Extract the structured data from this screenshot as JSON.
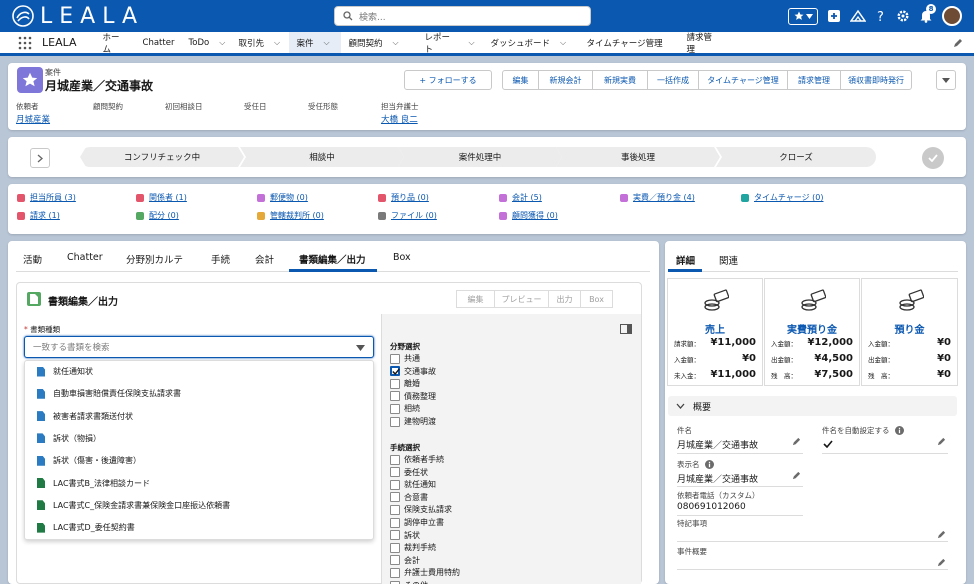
{
  "colors": {
    "brand": "#0b58b1",
    "record_icon": "#7f76d9",
    "doc_icon": "#54a862",
    "xls": "#1f7a43"
  },
  "header": {
    "logo": "LEALA",
    "search_placeholder": "検索...",
    "notification_count": "8"
  },
  "nav": {
    "app_name": "LEALA",
    "items": [
      {
        "label": "ホーム",
        "chevron": false
      },
      {
        "label": "Chatter",
        "chevron": false
      },
      {
        "label": "ToDo",
        "chevron": true
      },
      {
        "label": "取引先",
        "chevron": true
      },
      {
        "label": "案件",
        "chevron": true,
        "active": true
      },
      {
        "label": "顧問契約",
        "chevron": true
      },
      {
        "label": "レポート",
        "chevron": true
      },
      {
        "label": "ダッシュボード",
        "chevron": true
      },
      {
        "label": "タイムチャージ管理",
        "chevron": false
      },
      {
        "label": "請求管理",
        "chevron": false
      }
    ]
  },
  "record": {
    "type": "案件",
    "title": "月城産業／交通事故",
    "follow_label": "+ フォローする",
    "actions": [
      "編集",
      "新規会計",
      "新規実費",
      "一括作成",
      "タイムチャージ管理",
      "請求管理",
      "領収書即時発行"
    ],
    "fields": [
      {
        "label": "依頼者",
        "value": "月城産業",
        "link": true
      },
      {
        "label": "顧問契約",
        "value": ""
      },
      {
        "label": "初回相談日",
        "value": ""
      },
      {
        "label": "受任日",
        "value": ""
      },
      {
        "label": "受任形態",
        "value": ""
      },
      {
        "label": "担当弁護士",
        "value": "大橋 良二",
        "link": true
      }
    ]
  },
  "path": {
    "stages": [
      "コンフリチェック中",
      "相談中",
      "案件処理中",
      "事後処理",
      "クローズ"
    ]
  },
  "related": {
    "row1": [
      {
        "label": "担当所員 (3)",
        "color": "#e3556b"
      },
      {
        "label": "関係者 (1)",
        "color": "#e3556b"
      },
      {
        "label": "郵便物 (0)",
        "color": "#c470d9"
      },
      {
        "label": "預り品 (0)",
        "color": "#e3556b"
      },
      {
        "label": "会計 (5)",
        "color": "#c470d9"
      },
      {
        "label": "実費／預り金 (4)",
        "color": "#c470d9"
      },
      {
        "label": "タイムチャージ (0)",
        "color": "#21a5a0"
      }
    ],
    "row2": [
      {
        "label": "請求 (1)",
        "color": "#e3556b"
      },
      {
        "label": "配分 (0)",
        "color": "#54a862"
      },
      {
        "label": "管轄裁判所 (0)",
        "color": "#e5a93a"
      },
      {
        "label": "ファイル (0)",
        "color": "#7a7a7a"
      },
      {
        "label": "顧問獲得 (0)",
        "color": "#c470d9"
      }
    ]
  },
  "main": {
    "tabs": [
      "活動",
      "Chatter",
      "分野別カルテ",
      "手続",
      "会計",
      "書類編集／出力",
      "Box"
    ],
    "active_tab": "書類編集／出力",
    "panel_title": "書類編集／出力",
    "panel_buttons": [
      "編集",
      "プレビュー",
      "出力",
      "Box"
    ],
    "doc_type_label": "書類種類",
    "required_mark": "*",
    "combo_placeholder": "一致する書類を検索",
    "doc_options": [
      "就任通知状",
      "自動車損害賠償責任保険支払請求書",
      "被害者請求書類送付状",
      "訴状（物損）",
      "訴状（傷害・後遺障害）",
      "LAC書式B_法律相談カード",
      "LAC書式C_保険金請求書兼保険金口座振込依頼書",
      "LAC書式D_委任契約書"
    ],
    "field_section": "分野選択",
    "fields": [
      {
        "label": "共通",
        "checked": false
      },
      {
        "label": "交通事故",
        "checked": true
      },
      {
        "label": "離婚",
        "checked": false
      },
      {
        "label": "債務整理",
        "checked": false
      },
      {
        "label": "相続",
        "checked": false
      },
      {
        "label": "建物明渡",
        "checked": false
      }
    ],
    "proc_section": "手続選択",
    "procs": [
      {
        "label": "依頼者手続",
        "checked": false
      },
      {
        "label": "委任状",
        "checked": false
      },
      {
        "label": "就任通知",
        "checked": false
      },
      {
        "label": "合意書",
        "checked": false
      },
      {
        "label": "保険支払請求",
        "checked": false
      },
      {
        "label": "調停申立書",
        "checked": false
      },
      {
        "label": "訴状",
        "checked": false
      },
      {
        "label": "裁判手続",
        "checked": false
      },
      {
        "label": "会計",
        "checked": false
      },
      {
        "label": "弁護士費用特約",
        "checked": false
      },
      {
        "label": "その他",
        "checked": false
      }
    ]
  },
  "side": {
    "tabs": [
      "詳細",
      "関連"
    ],
    "summary": [
      {
        "title": "売上",
        "rows": [
          {
            "k": "請求額：",
            "v": "¥11,000"
          },
          {
            "k": "入金額：",
            "v": "¥0"
          },
          {
            "k": "未入金：",
            "v": "¥11,000"
          }
        ]
      },
      {
        "title": "実費預り金",
        "rows": [
          {
            "k": "入金額：",
            "v": "¥12,000"
          },
          {
            "k": "出金額：",
            "v": "¥4,500"
          },
          {
            "k": "残　高：",
            "v": "¥7,500"
          }
        ]
      },
      {
        "title": "預り金",
        "rows": [
          {
            "k": "入金額：",
            "v": "¥0"
          },
          {
            "k": "出金額：",
            "v": "¥0"
          },
          {
            "k": "残　高：",
            "v": "¥0"
          }
        ]
      }
    ],
    "overview_label": "概要",
    "details": {
      "case_name_label": "件名",
      "case_name": "月城産業／交通事故",
      "auto_label": "件名を自動設定する",
      "display_name_label": "表示名",
      "display_name": "月城産業／交通事故",
      "phone_label": "依頼者電話（カスタム）",
      "phone": "080691012060",
      "notes_label": "特記事項",
      "notes": "",
      "summary_label": "事件概要",
      "summary": ""
    }
  }
}
